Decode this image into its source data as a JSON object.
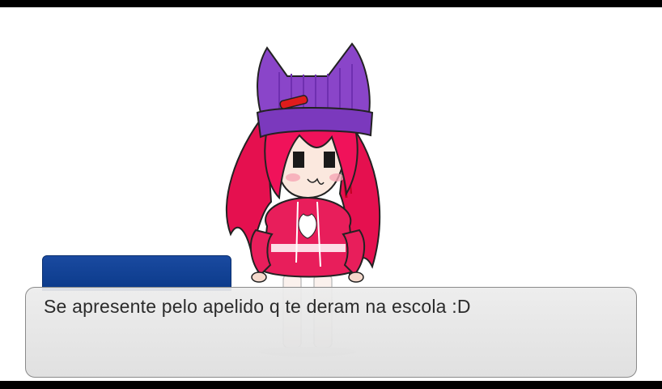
{
  "dialog": {
    "speaker_name": "",
    "text": "Se apresente pelo apelido q te deram na escola :D"
  },
  "character": {
    "hair_color": "#f0125a",
    "hat_color": "#8a45c9",
    "hoodie_color": "#e81e5b"
  },
  "theme": {
    "name_plate_color": "#0b3a8a",
    "dialog_bg": "#e6e6e6",
    "background": "#ffffff"
  }
}
